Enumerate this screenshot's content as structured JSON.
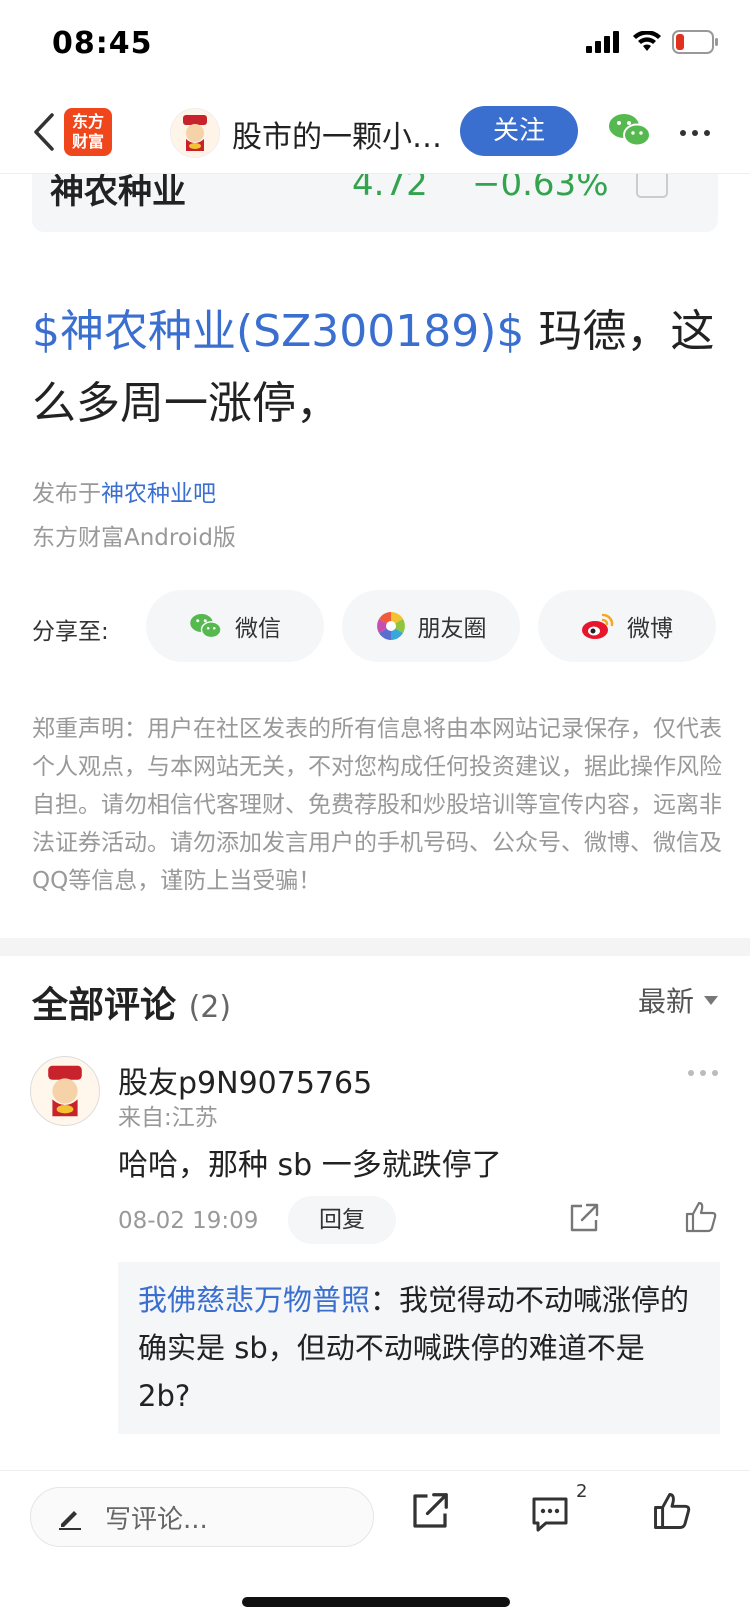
{
  "status_bar": {
    "time": "08:45"
  },
  "nav": {
    "logo_text_top": "东方",
    "logo_text_bottom": "财富",
    "title": "股市的一颗小…",
    "follow_label": "关注"
  },
  "stock_card": {
    "name": "神农种业",
    "price": "4.72",
    "change": "−0.63%"
  },
  "post": {
    "title_link": "$神农种业(SZ300189)$",
    "title_text": " 玛德，这么多周一涨停，",
    "published_prefix": "发布于",
    "published_link": "神农种业吧",
    "client": "东方财富Android版"
  },
  "share": {
    "label": "分享至:",
    "wechat": "微信",
    "moments": "朋友圈",
    "weibo": "微博"
  },
  "disclaimer": "郑重声明：用户在社区发表的所有信息将由本网站记录保存，仅代表个人观点，与本网站无关，不对您构成任何投资建议，据此操作风险自担。请勿相信代客理财、免费荐股和炒股培训等宣传内容，远离非法证券活动。请勿添加发言用户的手机号码、公众号、微博、微信及QQ等信息，谨防上当受骗！",
  "comments": {
    "header": "全部评论",
    "count": "(2)",
    "sort_label": "最新",
    "items": [
      {
        "user": "股友p9N9075765",
        "from": "来自:江苏",
        "text": "哈哈，那种 sb 一多就跌停了",
        "time": "08-02 19:09",
        "reply_label": "回复",
        "reply": {
          "user": "我佛慈悲万物普照",
          "separator": "：",
          "text": "我觉得动不动喊涨停的确实是 sb，但动不动喊跌停的难道不是 2b?"
        }
      }
    ]
  },
  "bottom_bar": {
    "input_placeholder": "写评论...",
    "comment_badge": "2"
  },
  "colors": {
    "accent_blue": "#3a6fd0",
    "stock_down_green": "#33a34d",
    "logo_orange": "#f0461c"
  }
}
